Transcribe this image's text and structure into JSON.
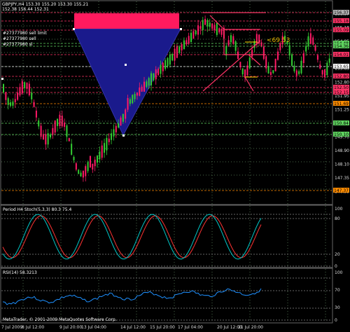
{
  "header": {
    "line1": "GBPJPY,H4  153.30 155.20 153.30 155.21",
    "line2": "152.38 156.44 152.31"
  },
  "orders": [
    "#27377980 sell limit",
    "#27377980 sell",
    "#27377980 sl"
  ],
  "annotation": "<69.53",
  "price_scale": [
    "156.37",
    "155.18",
    "154.85",
    "154.36",
    "153.65",
    "152.80",
    "151.95",
    "151.25",
    "150.45",
    "149.70",
    "148.90",
    "148.10",
    "147.35",
    "146.55"
  ],
  "price_tags": [
    {
      "text": "156.37",
      "color": "#b0b0b0"
    },
    {
      "text": "155.18",
      "color": "#ff3366"
    },
    {
      "text": "155.09",
      "color": "#ff3366"
    },
    {
      "text": "154.48",
      "color": "#5fd35f"
    },
    {
      "text": "154.36",
      "color": "#5fd35f"
    },
    {
      "text": "154.01",
      "color": "#ff3366"
    },
    {
      "text": "153.65",
      "color": "#ffffff"
    },
    {
      "text": "152.80",
      "color": "#ff3366"
    },
    {
      "text": "152.50",
      "color": "#ff3366"
    },
    {
      "text": "152.15",
      "color": "#ff3366"
    },
    {
      "text": "151.69",
      "color": "#ff8c00"
    },
    {
      "text": "150.84",
      "color": "#5fd35f"
    },
    {
      "text": "150.10",
      "color": "#5fd35f"
    },
    {
      "text": "147.37",
      "color": "#ff8c00"
    }
  ],
  "stoch": {
    "title": "Period H4 Stoch(5,3,3) 80.3 75.4",
    "scale": [
      "100",
      "80",
      "20",
      "0"
    ]
  },
  "rsi": {
    "title": "RSI(14) 58.3213",
    "scale": [
      "100",
      "70",
      "30",
      "0"
    ]
  },
  "copyright": "MetaTrader, © 2001-2009 MetaQuotes Software Corp.",
  "x_labels": [
    "7 Jul 2009",
    "8 Jul 12:00",
    "9 Jul 20:00",
    "13 Jul 04:00",
    "14 Jul 12:00",
    "15 Jul 20:00",
    "17 Jul 04:00",
    "20 Jul 12:00",
    "21 Jul 20:00"
  ],
  "colors": {
    "bull": "#33cc33",
    "bear": "#ff1a66",
    "grid": "#4a6a4a",
    "stochMain": "#00c8c8",
    "stochSignal": "#ff3333",
    "rsi": "#1e90ff",
    "triangle": "#1a1a8c",
    "rect": "#ff1a5e"
  }
}
